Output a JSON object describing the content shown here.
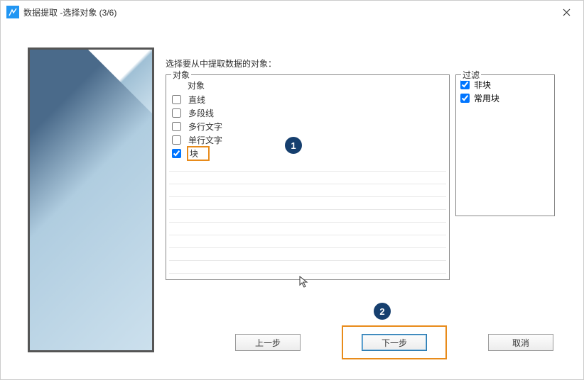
{
  "title": "数据提取 -选择对象 (3/6)",
  "instruction": "选择要从中提取数据的对象：",
  "objects": {
    "label": "对象",
    "header": "对象",
    "items": [
      {
        "label": "直线",
        "checked": false,
        "highlighted": false
      },
      {
        "label": "多段线",
        "checked": false,
        "highlighted": false
      },
      {
        "label": "多行文字",
        "checked": false,
        "highlighted": false
      },
      {
        "label": "单行文字",
        "checked": false,
        "highlighted": false
      },
      {
        "label": "块",
        "checked": true,
        "highlighted": true
      }
    ]
  },
  "filter": {
    "label": "过滤",
    "items": [
      {
        "label": "非块",
        "checked": true
      },
      {
        "label": "常用块",
        "checked": true
      }
    ]
  },
  "badges": {
    "one": "1",
    "two": "2"
  },
  "buttons": {
    "back": "上一步",
    "next": "下一步",
    "cancel": "取消"
  }
}
